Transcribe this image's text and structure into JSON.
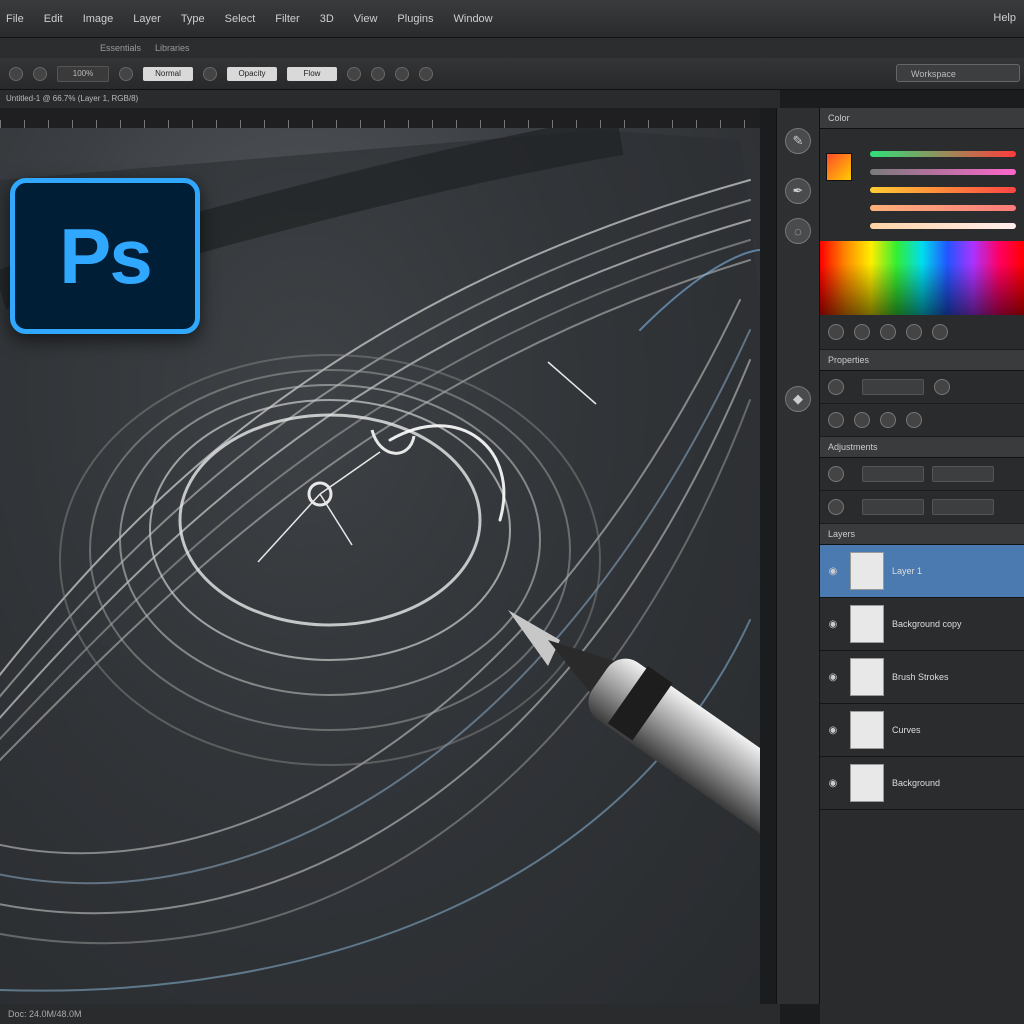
{
  "menubar": {
    "items": [
      "File",
      "Edit",
      "Image",
      "Layer",
      "Type",
      "Select",
      "Filter",
      "3D",
      "View",
      "Plugins",
      "Window"
    ],
    "right_label": "Help"
  },
  "subbar": {
    "items": [
      "Essentials",
      "Libraries"
    ]
  },
  "options": {
    "fields": [
      "100%",
      "Normal",
      "Opacity",
      "Flow"
    ],
    "workspace": "Workspace"
  },
  "document": {
    "tab": "Untitled-1 @ 66.7% (Layer 1, RGB/8)"
  },
  "logo": {
    "text": "Ps"
  },
  "status": {
    "text": "Doc: 24.0M/48.0M"
  },
  "toolstrip": {
    "icons": [
      "brush-icon",
      "pen-icon",
      "lasso-icon",
      "eyedropper-icon"
    ]
  },
  "panels": {
    "color_title": "Color",
    "properties_title": "Properties",
    "adjust_title": "Adjustments",
    "layers_title": "Layers"
  },
  "layers": [
    {
      "name": "Layer 1",
      "selected": true
    },
    {
      "name": "Background copy"
    },
    {
      "name": "Brush Strokes"
    },
    {
      "name": "Curves"
    },
    {
      "name": "Background"
    }
  ],
  "colors": {
    "accent": "#31a8ff",
    "logo_bg": "#001e36",
    "selection": "#4b7ab0"
  }
}
